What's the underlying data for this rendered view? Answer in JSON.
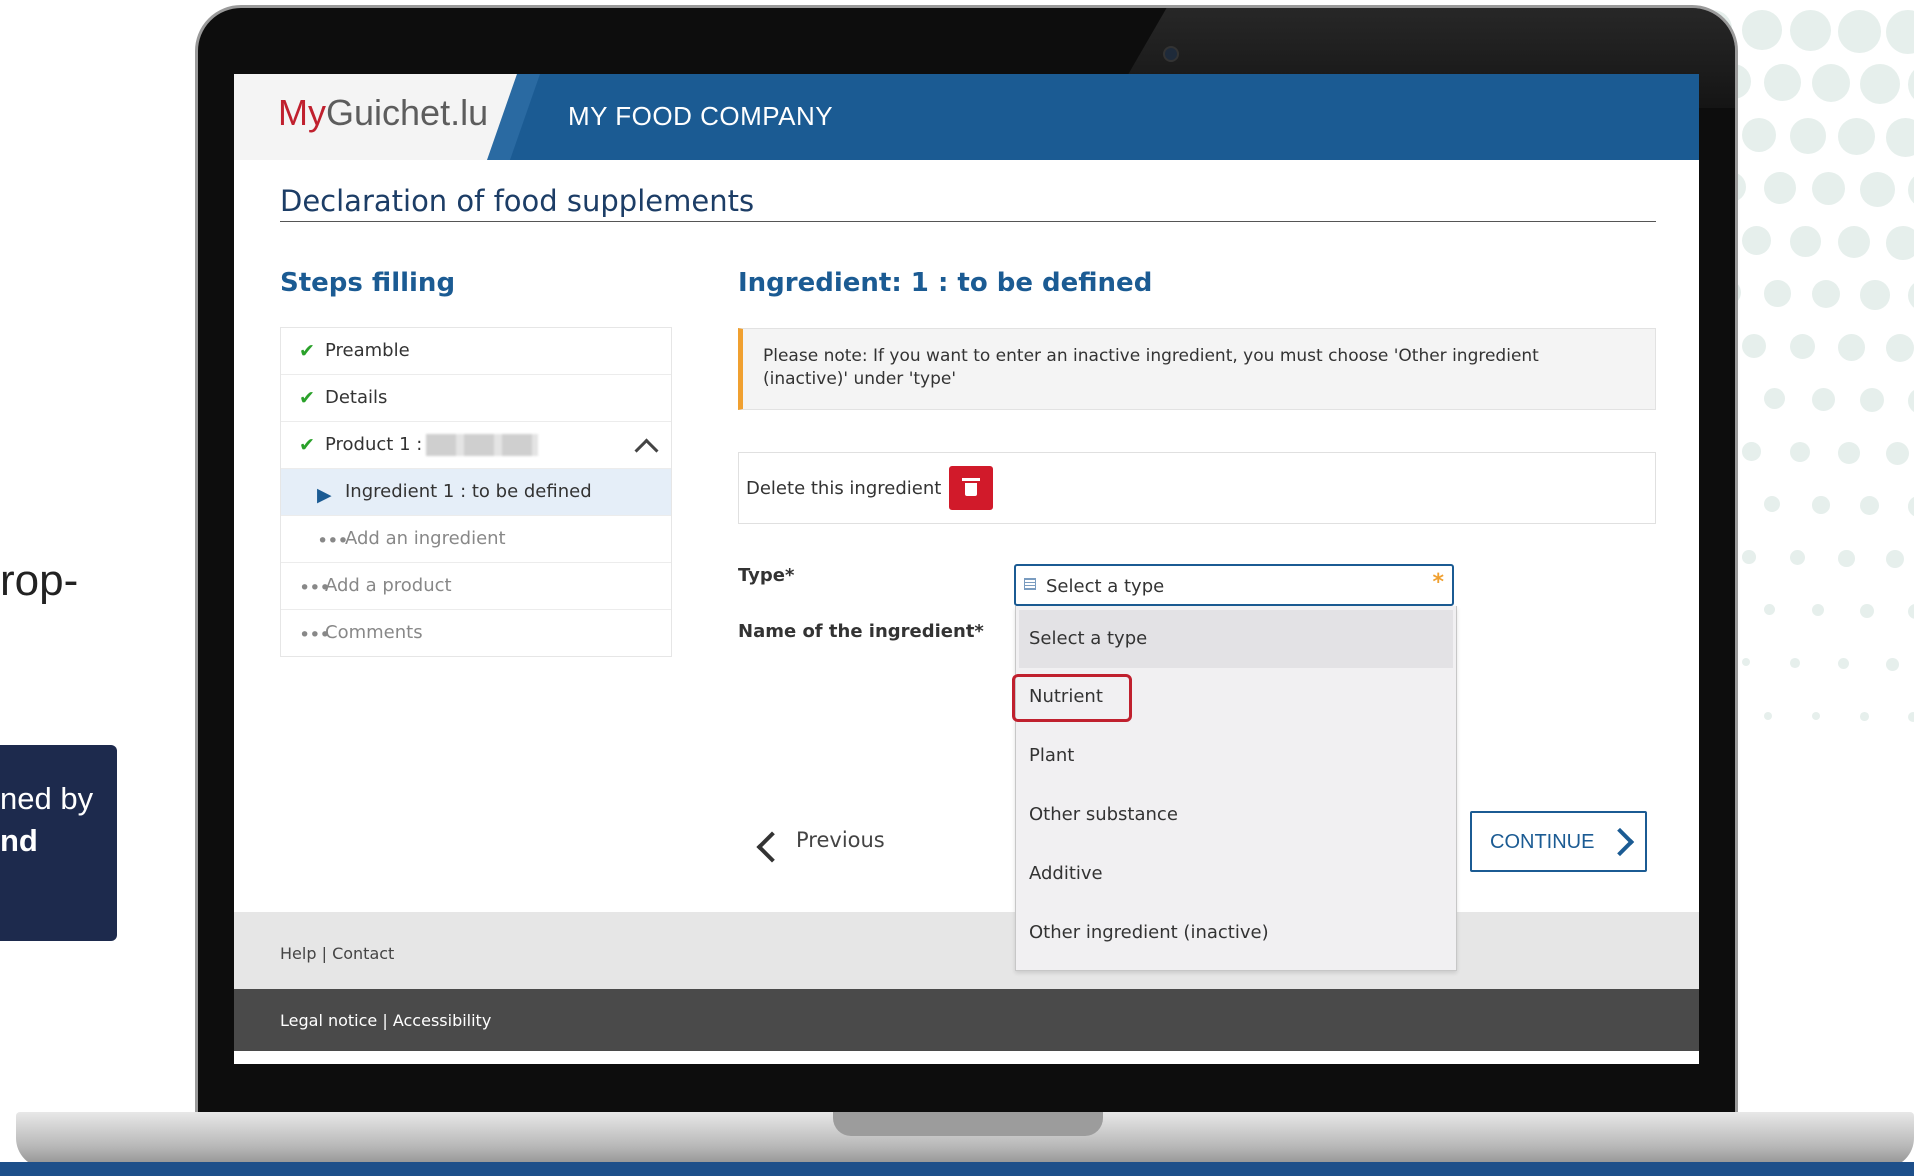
{
  "slide": {
    "left_fragment": "rop-",
    "box_line1": "ned by",
    "box_line2": "nd"
  },
  "header": {
    "logo_my": "My",
    "logo_rest": "Guichet.lu",
    "company": "MY FOOD COMPANY"
  },
  "page": {
    "title": "Declaration of food supplements"
  },
  "steps": {
    "title": "Steps filling",
    "items": [
      {
        "label": "Preamble",
        "icon": "check-icon"
      },
      {
        "label": "Details",
        "icon": "check-icon"
      },
      {
        "label": "Product 1 :",
        "icon": "check-icon"
      },
      {
        "label": "Ingredient 1 : to be defined",
        "icon": "triangle-right-icon"
      },
      {
        "label": "Add an ingredient",
        "icon": "ellipsis-icon"
      },
      {
        "label": "Add a product",
        "icon": "ellipsis-icon"
      },
      {
        "label": "Comments",
        "icon": "ellipsis-icon"
      }
    ]
  },
  "ingredient": {
    "title": "Ingredient: 1 : to be defined",
    "note": "Please note: If you want to enter an inactive ingredient, you must choose 'Other ingredient (inactive)' under 'type'",
    "delete_label": "Delete this ingredient",
    "type_label": "Type*",
    "name_label": "Name of the ingredient*",
    "type_select_value": "Select a type",
    "type_options": [
      "Select a type",
      "Nutrient",
      "Plant",
      "Other substance",
      "Additive",
      "Other ingredient (inactive)"
    ]
  },
  "nav": {
    "previous": "Previous",
    "continue": "CONTINUE"
  },
  "footer": {
    "help": "Help",
    "sep": "|",
    "contact": "Contact",
    "legal": "Legal notice",
    "accessibility": "Accessibility"
  },
  "colors": {
    "brand_blue": "#1b5b93",
    "brand_red": "#c0202e",
    "check_green": "#2aa12a",
    "note_accent": "#f0a030"
  }
}
